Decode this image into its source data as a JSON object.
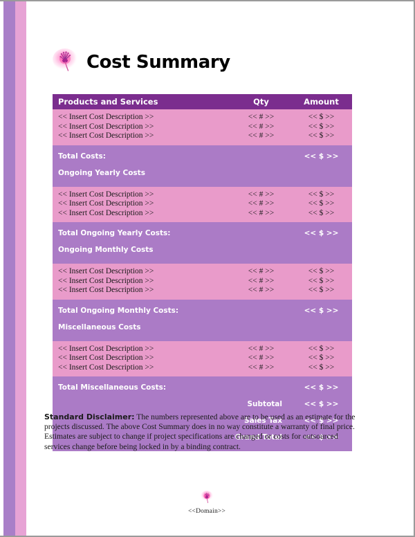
{
  "document": {
    "title": "Cost Summary",
    "logo_icon": "pink-flower-bloom-icon"
  },
  "table": {
    "columns": {
      "description": "Products and Services",
      "qty": "Qty",
      "amount": "Amount"
    },
    "placeholders": {
      "description": "<< Insert Cost Description >>",
      "qty": "<< # >>",
      "amount": "<< $ >>"
    },
    "sections": [
      {
        "heading": null,
        "rows": [
          {
            "description": "<< Insert Cost Description >>",
            "qty": "<< # >>",
            "amount": "<< $ >>"
          },
          {
            "description": "<< Insert Cost Description >>",
            "qty": "<< # >>",
            "amount": "<< $ >>"
          },
          {
            "description": "<< Insert Cost Description >>",
            "qty": "<< # >>",
            "amount": "<< $ >>"
          }
        ],
        "total_label": "Total Costs:",
        "total_amount": "<< $ >>",
        "next_heading": "Ongoing Yearly Costs"
      },
      {
        "heading": "Ongoing Yearly Costs",
        "rows": [
          {
            "description": "<< Insert Cost Description >>",
            "qty": "<< # >>",
            "amount": "<< $ >>"
          },
          {
            "description": "<< Insert Cost Description >>",
            "qty": "<< # >>",
            "amount": "<< $ >>"
          },
          {
            "description": "<< Insert Cost Description >>",
            "qty": "<< # >>",
            "amount": "<< $ >>"
          }
        ],
        "total_label": "Total Ongoing Yearly Costs:",
        "total_amount": "<< $ >>",
        "next_heading": "Ongoing Monthly Costs"
      },
      {
        "heading": "Ongoing Monthly Costs",
        "rows": [
          {
            "description": "<< Insert Cost Description >>",
            "qty": "<< # >>",
            "amount": "<< $ >>"
          },
          {
            "description": "<< Insert Cost Description >>",
            "qty": "<< # >>",
            "amount": "<< $ >>"
          },
          {
            "description": "<< Insert Cost Description >>",
            "qty": "<< # >>",
            "amount": "<< $ >>"
          }
        ],
        "total_label": "Total Ongoing Monthly Costs:",
        "total_amount": "<< $ >>",
        "next_heading": "Miscellaneous Costs"
      },
      {
        "heading": "Miscellaneous Costs",
        "rows": [
          {
            "description": "<< Insert Cost Description >>",
            "qty": "<< # >>",
            "amount": "<< $ >>"
          },
          {
            "description": "<< Insert Cost Description >>",
            "qty": "<< # >>",
            "amount": "<< $ >>"
          },
          {
            "description": "<< Insert Cost Description >>",
            "qty": "<< # >>",
            "amount": "<< $ >>"
          }
        ],
        "total_label": "Total Miscellaneous Costs:",
        "total_amount": "<< $ >>",
        "next_heading": null
      }
    ],
    "footer_totals": [
      {
        "label": "Subtotal",
        "amount": "<< $ >>"
      },
      {
        "label": "Sales Tax",
        "amount": "<< $ >>"
      },
      {
        "label": "Grand Total",
        "amount": "<< $ >>"
      }
    ]
  },
  "disclaimer": {
    "heading": "Standard Disclaimer:",
    "body": " The numbers represented above are to be used as an estimate for the projects discussed. The above Cost Summary does in no way constitute a warranty of final price.  Estimates are subject to change if project specifications are changed or costs for outsourced services change before being locked in by a binding contract."
  },
  "footer": {
    "domain": "<<Domain>>",
    "logo_icon": "pink-flower-bloom-icon"
  },
  "colors": {
    "header_purple": "#7b2d8e",
    "section_purple": "#ab7bc6",
    "data_pink": "#e99bca",
    "stripe_purple": "#a97fc8",
    "stripe_pink": "#e7a3d5"
  }
}
